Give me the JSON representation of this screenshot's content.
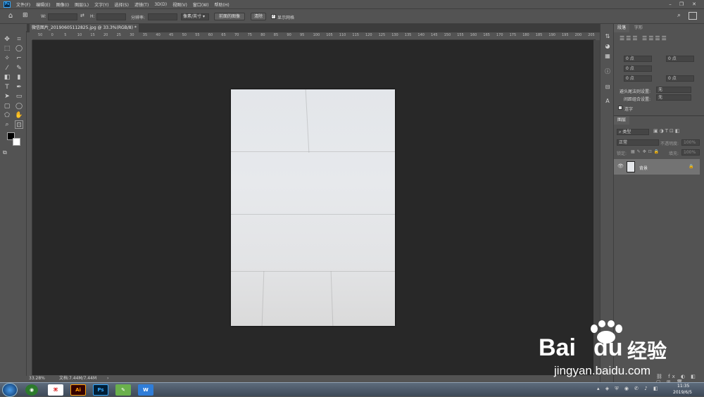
{
  "menubar": {
    "items": [
      "文件(F)",
      "编辑(E)",
      "图像(I)",
      "图层(L)",
      "文字(Y)",
      "选择(S)",
      "滤镜(T)",
      "3D(D)",
      "视图(V)",
      "窗口(W)",
      "帮助(H)"
    ],
    "logo": "Ps"
  },
  "options": {
    "w_label": "W:",
    "h_label": "H:",
    "resolution_label": "分辨率:",
    "unit_select": "像素/英寸",
    "front_image_btn": "前面的图像",
    "clear_btn": "清除",
    "show_grid_label": "显示网格"
  },
  "document": {
    "tab_title": "微信图片_20190605112825.jpg @ 33.3%(RGB/8) *",
    "close": "×"
  },
  "ruler_top": [
    "50",
    "0",
    "5",
    "10",
    "15",
    "20",
    "25",
    "30",
    "35",
    "40",
    "45",
    "50",
    "55",
    "60",
    "65",
    "70",
    "75",
    "80",
    "85",
    "90",
    "95",
    "100",
    "105",
    "110",
    "115",
    "120",
    "125",
    "130",
    "135",
    "140",
    "145",
    "150",
    "155",
    "160",
    "165",
    "170",
    "175",
    "180",
    "185",
    "190",
    "195",
    "200",
    "205"
  ],
  "status": {
    "zoom": "33.28%",
    "doc_info": "文档:7.44M/7.44M",
    "arrow": "›"
  },
  "paragraph_panel": {
    "tab_paragraph": "段落",
    "tab_char": "字形",
    "fields": [
      "0 点",
      "0 点",
      "0 点",
      "0 点",
      "0 点"
    ],
    "avoid_label": "避头尾法则设置:",
    "avoid_value": "无",
    "spacing_label": "间距组合设置:",
    "spacing_value": "无",
    "hyphen_label": "连字"
  },
  "layers_panel": {
    "tab": "图层",
    "search": "类型",
    "blend_mode": "正常",
    "opacity_label": "不透明度:",
    "opacity_value": "100%",
    "lock_label": "锁定:",
    "fill_label": "填充:",
    "fill_value": "100%",
    "layer_name": "背景"
  },
  "taskbar": {
    "time": "11:35",
    "date": "2019/6/5",
    "apps": [
      "Ai",
      "Ps"
    ]
  },
  "watermark": {
    "brand": "Bai",
    "brand2": "du",
    "cn": "经验",
    "url": "jingyan.baidu.com"
  },
  "colors": {
    "ps_blue": "#31a8ff",
    "ai_orange": "#ff9a00",
    "canvas_bg": "#282828",
    "panel_bg": "#535353"
  }
}
